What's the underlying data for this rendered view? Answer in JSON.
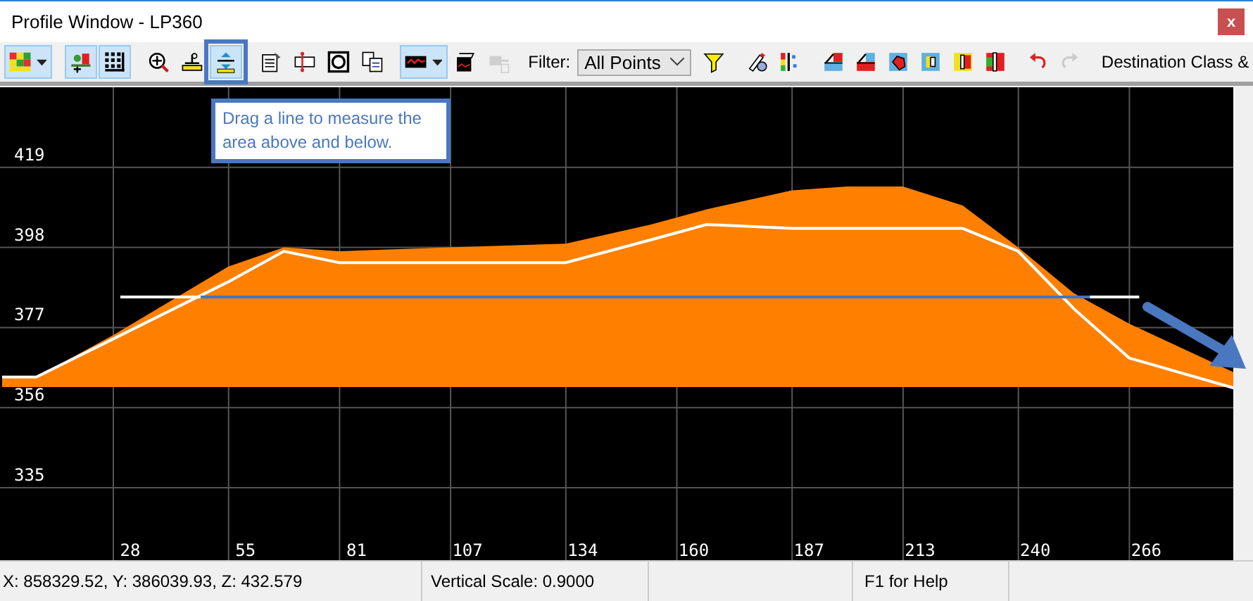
{
  "window": {
    "title": "Profile Window - LP360",
    "close": "x"
  },
  "toolbar": {
    "buttons_left": [
      {
        "pressed": true,
        "dropdown": true,
        "disabled": false,
        "highlighted": false
      },
      {
        "pressed": true,
        "dropdown": false,
        "disabled": false,
        "highlighted": false
      },
      {
        "pressed": true,
        "dropdown": false,
        "disabled": false,
        "highlighted": false
      },
      {
        "pressed": false,
        "dropdown": false,
        "disabled": false,
        "highlighted": false
      },
      {
        "pressed": false,
        "dropdown": false,
        "disabled": false,
        "highlighted": false
      },
      {
        "pressed": true,
        "dropdown": false,
        "disabled": false,
        "highlighted": true
      },
      {
        "pressed": false,
        "dropdown": false,
        "disabled": false,
        "highlighted": false
      },
      {
        "pressed": false,
        "dropdown": false,
        "disabled": false,
        "highlighted": false
      },
      {
        "pressed": false,
        "dropdown": false,
        "disabled": false,
        "highlighted": false
      },
      {
        "pressed": false,
        "dropdown": false,
        "disabled": false,
        "highlighted": false
      },
      {
        "pressed": true,
        "dropdown": true,
        "disabled": false,
        "highlighted": false
      },
      {
        "pressed": false,
        "dropdown": false,
        "disabled": false,
        "highlighted": false
      },
      {
        "pressed": false,
        "dropdown": false,
        "disabled": true,
        "highlighted": false
      }
    ],
    "filter": {
      "label": "Filter:",
      "value": "All Points"
    },
    "buttons_right": [
      {
        "pressed": false,
        "disabled": false
      },
      {
        "pressed": false,
        "disabled": false
      },
      {
        "pressed": false,
        "disabled": false
      },
      {
        "pressed": false,
        "disabled": false
      },
      {
        "pressed": false,
        "disabled": false
      },
      {
        "pressed": false,
        "disabled": false
      },
      {
        "pressed": false,
        "disabled": false
      },
      {
        "pressed": false,
        "disabled": false
      },
      {
        "pressed": false,
        "disabled": false
      },
      {
        "pressed": false,
        "disabled": false
      },
      {
        "pressed": false,
        "disabled": true
      }
    ],
    "label_right": "Destination Class &"
  },
  "tooltip": {
    "text": "Drag a line to measure the area above and below."
  },
  "profile": {
    "chart_data": {
      "type": "area",
      "x": [
        -2,
        6,
        24,
        51,
        64,
        77,
        103,
        130,
        150,
        163,
        183,
        196,
        209,
        223,
        236,
        249,
        262,
        287
      ],
      "xlim": [
        -2.5,
        291
      ],
      "ylim": [
        316,
        440
      ],
      "grid": true,
      "xticks": [
        28,
        55,
        81,
        107,
        134,
        160,
        187,
        213,
        240,
        266
      ],
      "yticks": [
        335,
        356,
        377,
        398,
        419
      ],
      "series": [
        {
          "color": "#ff8000",
          "values": [
            364,
            364,
            375,
            393,
            398,
            397,
            398,
            399,
            404,
            408,
            413,
            414,
            414,
            409,
            398,
            386,
            378,
            365
          ]
        },
        {
          "type": "line",
          "color": "#ffffff",
          "values": [
            364,
            364,
            374,
            389,
            397,
            394,
            394,
            394,
            400,
            404,
            403,
            403,
            403,
            403,
            397,
            382,
            369,
            361
          ]
        }
      ],
      "ref_lines": [
        {
          "axis": "y",
          "value": 385,
          "color": "#ffffff"
        },
        {
          "axis": "y",
          "value": 385,
          "color": "#3a78c8"
        }
      ]
    }
  },
  "status_bar": {
    "coordinates": "X: 858329.52, Y: 386039.93, Z: 432.579",
    "vertical_scale": "Vertical Scale: 0.9000",
    "help": "F1 for Help"
  }
}
